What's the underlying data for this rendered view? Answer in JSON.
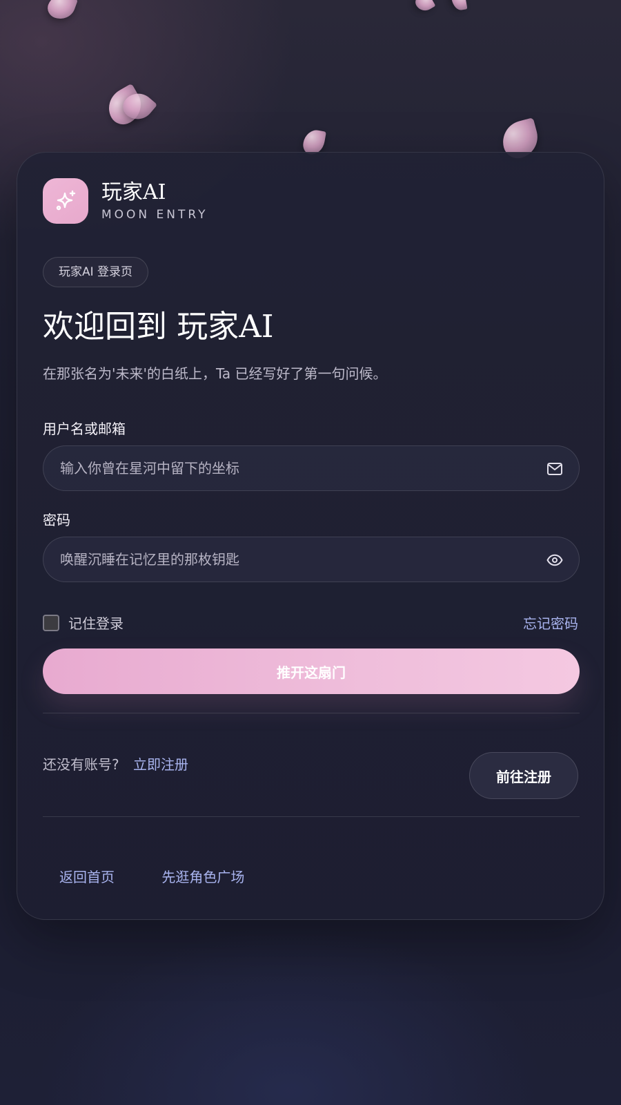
{
  "brand": {
    "name": "玩家AI",
    "subtitle": "MOON ENTRY",
    "logo_icon": "sparkles-icon",
    "logo_color": "#eeb6d6"
  },
  "page_badge": "玩家AI 登录页",
  "heading": "欢迎回到 玩家AI",
  "tagline": "在那张名为'未来'的白纸上，Ta 已经写好了第一句问候。",
  "form": {
    "username": {
      "label": "用户名或邮箱",
      "placeholder": "输入你曾在星河中留下的坐标",
      "value": "",
      "icon": "mail-icon"
    },
    "password": {
      "label": "密码",
      "placeholder": "唤醒沉睡在记忆里的那枚钥匙",
      "value": "",
      "icon": "eye-icon"
    },
    "remember_label": "记住登录",
    "remember_checked": false,
    "forgot_label": "忘记密码",
    "submit_label": "推开这扇门"
  },
  "register": {
    "question": "还没有账号?",
    "link_label": "立即注册",
    "button_label": "前往注册"
  },
  "footer_links": [
    "返回首页",
    "先逛角色广场"
  ],
  "colors": {
    "accent_pink": "#e8aad0",
    "link_blue": "#a9b4ef",
    "background": "#1e1f31"
  }
}
